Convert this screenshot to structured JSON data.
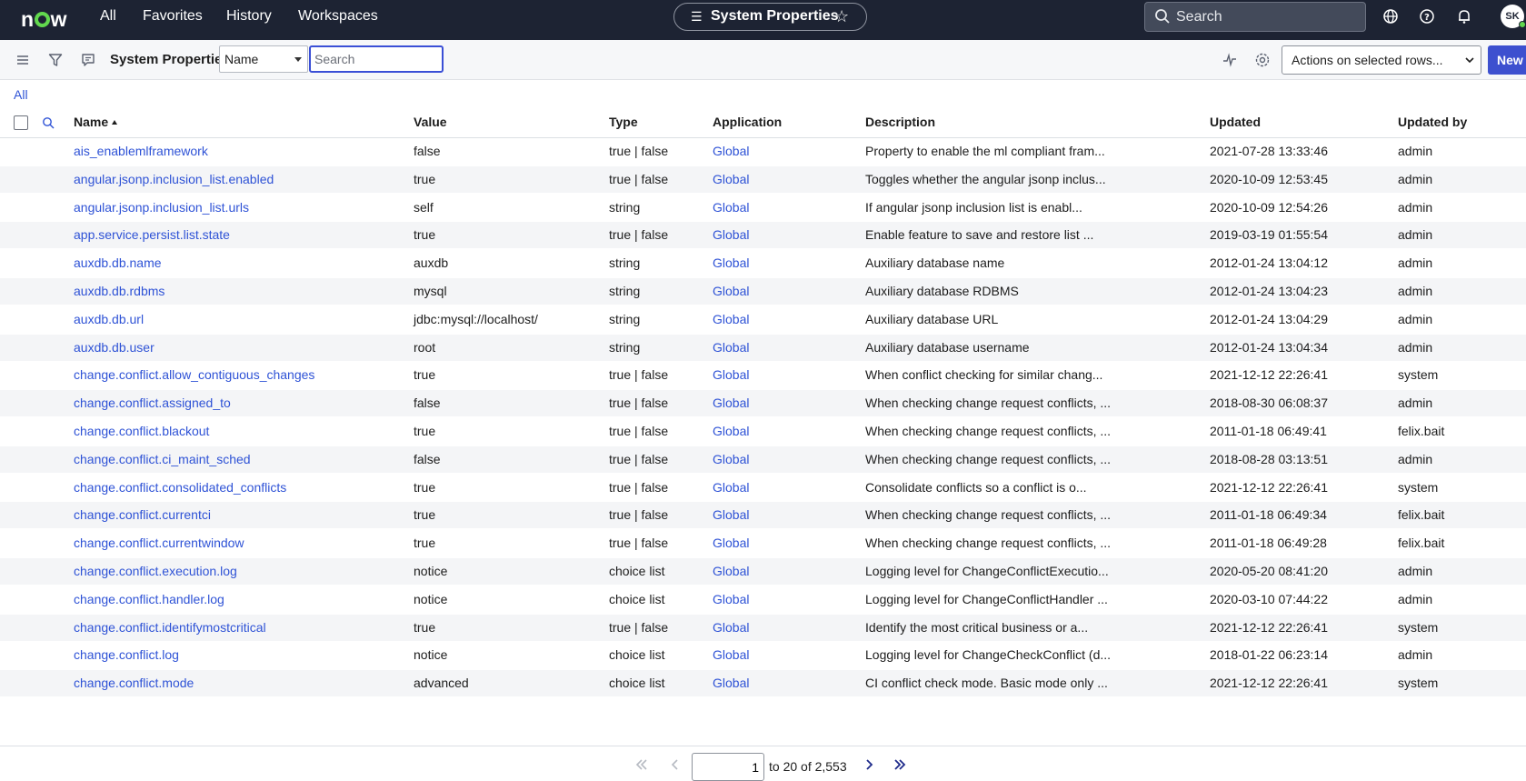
{
  "topbar": {
    "logo": "now",
    "nav": [
      "All",
      "Favorites",
      "History",
      "Workspaces"
    ],
    "page_pill": "System Properties",
    "search_placeholder": "Search",
    "avatar": "SK"
  },
  "toolbar": {
    "title": "System Properties",
    "field_select": "Name",
    "search_placeholder": "Search",
    "actions_label": "Actions on selected rows...",
    "new_label": "New"
  },
  "breadcrumb": "All",
  "columns": [
    "Name",
    "Value",
    "Type",
    "Application",
    "Description",
    "Updated",
    "Updated by"
  ],
  "rows": [
    {
      "name": "ais_enablemlframework",
      "value": "false",
      "type": "true | false",
      "app": "Global",
      "desc": "Property to enable the ml compliant fram...",
      "updated": "2021-07-28 13:33:46",
      "by": "admin"
    },
    {
      "name": "angular.jsonp.inclusion_list.enabled",
      "value": "true",
      "type": "true | false",
      "app": "Global",
      "desc": "Toggles whether the angular jsonp inclus...",
      "updated": "2020-10-09 12:53:45",
      "by": "admin"
    },
    {
      "name": "angular.jsonp.inclusion_list.urls",
      "value": "self",
      "type": "string",
      "app": "Global",
      "desc": "If angular jsonp inclusion list is enabl...",
      "updated": "2020-10-09 12:54:26",
      "by": "admin"
    },
    {
      "name": "app.service.persist.list.state",
      "value": "true",
      "type": "true | false",
      "app": "Global",
      "desc": "Enable feature to save and restore list ...",
      "updated": "2019-03-19 01:55:54",
      "by": "admin"
    },
    {
      "name": "auxdb.db.name",
      "value": "auxdb",
      "type": "string",
      "app": "Global",
      "desc": "Auxiliary database name",
      "updated": "2012-01-24 13:04:12",
      "by": "admin"
    },
    {
      "name": "auxdb.db.rdbms",
      "value": "mysql",
      "type": "string",
      "app": "Global",
      "desc": "Auxiliary database RDBMS",
      "updated": "2012-01-24 13:04:23",
      "by": "admin"
    },
    {
      "name": "auxdb.db.url",
      "value": "jdbc:mysql://localhost/",
      "type": "string",
      "app": "Global",
      "desc": "Auxiliary database URL",
      "updated": "2012-01-24 13:04:29",
      "by": "admin"
    },
    {
      "name": "auxdb.db.user",
      "value": "root",
      "type": "string",
      "app": "Global",
      "desc": "Auxiliary database username",
      "updated": "2012-01-24 13:04:34",
      "by": "admin"
    },
    {
      "name": "change.conflict.allow_contiguous_changes",
      "value": "true",
      "type": "true | false",
      "app": "Global",
      "desc": "When conflict checking for similar chang...",
      "updated": "2021-12-12 22:26:41",
      "by": "system"
    },
    {
      "name": "change.conflict.assigned_to",
      "value": "false",
      "type": "true | false",
      "app": "Global",
      "desc": "When checking change request conflicts, ...",
      "updated": "2018-08-30 06:08:37",
      "by": "admin"
    },
    {
      "name": "change.conflict.blackout",
      "value": "true",
      "type": "true | false",
      "app": "Global",
      "desc": "When checking change request conflicts, ...",
      "updated": "2011-01-18 06:49:41",
      "by": "felix.bait"
    },
    {
      "name": "change.conflict.ci_maint_sched",
      "value": "false",
      "type": "true | false",
      "app": "Global",
      "desc": "When checking change request conflicts, ...",
      "updated": "2018-08-28 03:13:51",
      "by": "admin"
    },
    {
      "name": "change.conflict.consolidated_conflicts",
      "value": "true",
      "type": "true | false",
      "app": "Global",
      "desc": "Consolidate conflicts so a conflict is o...",
      "updated": "2021-12-12 22:26:41",
      "by": "system"
    },
    {
      "name": "change.conflict.currentci",
      "value": "true",
      "type": "true | false",
      "app": "Global",
      "desc": "When checking change request conflicts, ...",
      "updated": "2011-01-18 06:49:34",
      "by": "felix.bait"
    },
    {
      "name": "change.conflict.currentwindow",
      "value": "true",
      "type": "true | false",
      "app": "Global",
      "desc": "When checking change request conflicts, ...",
      "updated": "2011-01-18 06:49:28",
      "by": "felix.bait"
    },
    {
      "name": "change.conflict.execution.log",
      "value": "notice",
      "type": "choice list",
      "app": "Global",
      "desc": "Logging level for ChangeConflictExecutio...",
      "updated": "2020-05-20 08:41:20",
      "by": "admin"
    },
    {
      "name": "change.conflict.handler.log",
      "value": "notice",
      "type": "choice list",
      "app": "Global",
      "desc": "Logging level for ChangeConflictHandler ...",
      "updated": "2020-03-10 07:44:22",
      "by": "admin"
    },
    {
      "name": "change.conflict.identifymostcritical",
      "value": "true",
      "type": "true | false",
      "app": "Global",
      "desc": "Identify the most critical business or a...",
      "updated": "2021-12-12 22:26:41",
      "by": "system"
    },
    {
      "name": "change.conflict.log",
      "value": "notice",
      "type": "choice list",
      "app": "Global",
      "desc": "Logging level for ChangeCheckConflict (d...",
      "updated": "2018-01-22 06:23:14",
      "by": "admin"
    },
    {
      "name": "change.conflict.mode",
      "value": "advanced",
      "type": "choice list",
      "app": "Global",
      "desc": "CI conflict check mode. Basic mode only ...",
      "updated": "2021-12-12 22:26:41",
      "by": "system"
    }
  ],
  "pagination": {
    "current": "1",
    "range_text": "to 20 of 2,553"
  },
  "colors": {
    "topbar": "#1d2333",
    "accent": "#3d50cf",
    "link": "#2f53d6",
    "logo_green": "#62d84e"
  }
}
